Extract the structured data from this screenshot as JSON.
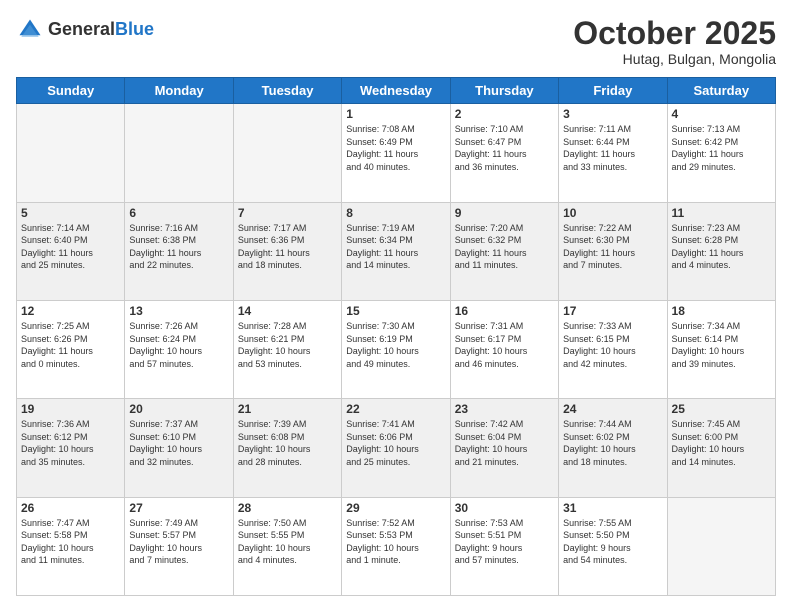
{
  "logo": {
    "general": "General",
    "blue": "Blue"
  },
  "header": {
    "title": "October 2025",
    "location": "Hutag, Bulgan, Mongolia"
  },
  "weekdays": [
    "Sunday",
    "Monday",
    "Tuesday",
    "Wednesday",
    "Thursday",
    "Friday",
    "Saturday"
  ],
  "weeks": [
    [
      {
        "day": "",
        "info": ""
      },
      {
        "day": "",
        "info": ""
      },
      {
        "day": "",
        "info": ""
      },
      {
        "day": "1",
        "info": "Sunrise: 7:08 AM\nSunset: 6:49 PM\nDaylight: 11 hours\nand 40 minutes."
      },
      {
        "day": "2",
        "info": "Sunrise: 7:10 AM\nSunset: 6:47 PM\nDaylight: 11 hours\nand 36 minutes."
      },
      {
        "day": "3",
        "info": "Sunrise: 7:11 AM\nSunset: 6:44 PM\nDaylight: 11 hours\nand 33 minutes."
      },
      {
        "day": "4",
        "info": "Sunrise: 7:13 AM\nSunset: 6:42 PM\nDaylight: 11 hours\nand 29 minutes."
      }
    ],
    [
      {
        "day": "5",
        "info": "Sunrise: 7:14 AM\nSunset: 6:40 PM\nDaylight: 11 hours\nand 25 minutes."
      },
      {
        "day": "6",
        "info": "Sunrise: 7:16 AM\nSunset: 6:38 PM\nDaylight: 11 hours\nand 22 minutes."
      },
      {
        "day": "7",
        "info": "Sunrise: 7:17 AM\nSunset: 6:36 PM\nDaylight: 11 hours\nand 18 minutes."
      },
      {
        "day": "8",
        "info": "Sunrise: 7:19 AM\nSunset: 6:34 PM\nDaylight: 11 hours\nand 14 minutes."
      },
      {
        "day": "9",
        "info": "Sunrise: 7:20 AM\nSunset: 6:32 PM\nDaylight: 11 hours\nand 11 minutes."
      },
      {
        "day": "10",
        "info": "Sunrise: 7:22 AM\nSunset: 6:30 PM\nDaylight: 11 hours\nand 7 minutes."
      },
      {
        "day": "11",
        "info": "Sunrise: 7:23 AM\nSunset: 6:28 PM\nDaylight: 11 hours\nand 4 minutes."
      }
    ],
    [
      {
        "day": "12",
        "info": "Sunrise: 7:25 AM\nSunset: 6:26 PM\nDaylight: 11 hours\nand 0 minutes."
      },
      {
        "day": "13",
        "info": "Sunrise: 7:26 AM\nSunset: 6:24 PM\nDaylight: 10 hours\nand 57 minutes."
      },
      {
        "day": "14",
        "info": "Sunrise: 7:28 AM\nSunset: 6:21 PM\nDaylight: 10 hours\nand 53 minutes."
      },
      {
        "day": "15",
        "info": "Sunrise: 7:30 AM\nSunset: 6:19 PM\nDaylight: 10 hours\nand 49 minutes."
      },
      {
        "day": "16",
        "info": "Sunrise: 7:31 AM\nSunset: 6:17 PM\nDaylight: 10 hours\nand 46 minutes."
      },
      {
        "day": "17",
        "info": "Sunrise: 7:33 AM\nSunset: 6:15 PM\nDaylight: 10 hours\nand 42 minutes."
      },
      {
        "day": "18",
        "info": "Sunrise: 7:34 AM\nSunset: 6:14 PM\nDaylight: 10 hours\nand 39 minutes."
      }
    ],
    [
      {
        "day": "19",
        "info": "Sunrise: 7:36 AM\nSunset: 6:12 PM\nDaylight: 10 hours\nand 35 minutes."
      },
      {
        "day": "20",
        "info": "Sunrise: 7:37 AM\nSunset: 6:10 PM\nDaylight: 10 hours\nand 32 minutes."
      },
      {
        "day": "21",
        "info": "Sunrise: 7:39 AM\nSunset: 6:08 PM\nDaylight: 10 hours\nand 28 minutes."
      },
      {
        "day": "22",
        "info": "Sunrise: 7:41 AM\nSunset: 6:06 PM\nDaylight: 10 hours\nand 25 minutes."
      },
      {
        "day": "23",
        "info": "Sunrise: 7:42 AM\nSunset: 6:04 PM\nDaylight: 10 hours\nand 21 minutes."
      },
      {
        "day": "24",
        "info": "Sunrise: 7:44 AM\nSunset: 6:02 PM\nDaylight: 10 hours\nand 18 minutes."
      },
      {
        "day": "25",
        "info": "Sunrise: 7:45 AM\nSunset: 6:00 PM\nDaylight: 10 hours\nand 14 minutes."
      }
    ],
    [
      {
        "day": "26",
        "info": "Sunrise: 7:47 AM\nSunset: 5:58 PM\nDaylight: 10 hours\nand 11 minutes."
      },
      {
        "day": "27",
        "info": "Sunrise: 7:49 AM\nSunset: 5:57 PM\nDaylight: 10 hours\nand 7 minutes."
      },
      {
        "day": "28",
        "info": "Sunrise: 7:50 AM\nSunset: 5:55 PM\nDaylight: 10 hours\nand 4 minutes."
      },
      {
        "day": "29",
        "info": "Sunrise: 7:52 AM\nSunset: 5:53 PM\nDaylight: 10 hours\nand 1 minute."
      },
      {
        "day": "30",
        "info": "Sunrise: 7:53 AM\nSunset: 5:51 PM\nDaylight: 9 hours\nand 57 minutes."
      },
      {
        "day": "31",
        "info": "Sunrise: 7:55 AM\nSunset: 5:50 PM\nDaylight: 9 hours\nand 54 minutes."
      },
      {
        "day": "",
        "info": ""
      }
    ]
  ]
}
